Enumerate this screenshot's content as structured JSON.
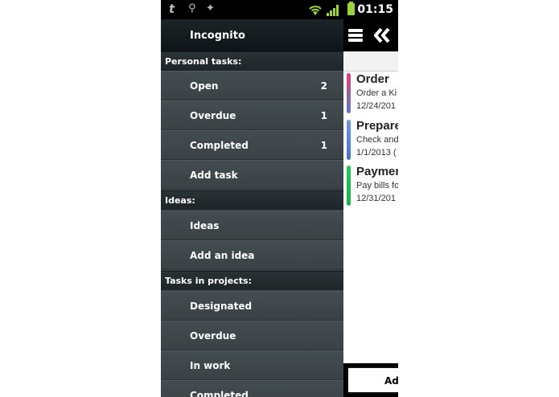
{
  "status_bar": {
    "time": "01:15",
    "icons": [
      "tapatalk-icon",
      "usb-icon",
      "android-debug-icon",
      "wifi-icon",
      "signal-icon",
      "battery-icon"
    ]
  },
  "drawer": {
    "title": "Incognito",
    "sections": [
      {
        "label": "Personal tasks:",
        "items": [
          {
            "label": "Open",
            "count": "2"
          },
          {
            "label": "Overdue",
            "count": "1"
          },
          {
            "label": "Completed",
            "count": "1"
          },
          {
            "label": "Add task",
            "count": ""
          }
        ]
      },
      {
        "label": "Ideas:",
        "items": [
          {
            "label": "Ideas",
            "count": ""
          },
          {
            "label": "Add an idea",
            "count": ""
          }
        ]
      },
      {
        "label": "Tasks in projects:",
        "items": [
          {
            "label": "Designated",
            "count": ""
          },
          {
            "label": "Overdue",
            "count": ""
          },
          {
            "label": "In work",
            "count": ""
          },
          {
            "label": "Completed",
            "count": ""
          }
        ]
      }
    ]
  },
  "tasks": [
    {
      "title": "Order",
      "desc": "Order a Ki",
      "date": "12/24/201",
      "color_top": "#e0407a",
      "color_bottom": "#5b78c8"
    },
    {
      "title": "Prepare",
      "desc": "Check and",
      "date": "1/1/2013 (",
      "color_top": "#6b9ad8",
      "color_bottom": "#4a72c0"
    },
    {
      "title": "Paymen",
      "desc": "Pay bills fo",
      "date": "12/31/201",
      "color_top": "#22cc55",
      "color_bottom": "#18b048"
    }
  ],
  "add_button_label": "Add",
  "colors": {
    "drawer_bg": "#3b4347",
    "header_bg": "#0f1518",
    "accent_green": "#9bd43a"
  }
}
